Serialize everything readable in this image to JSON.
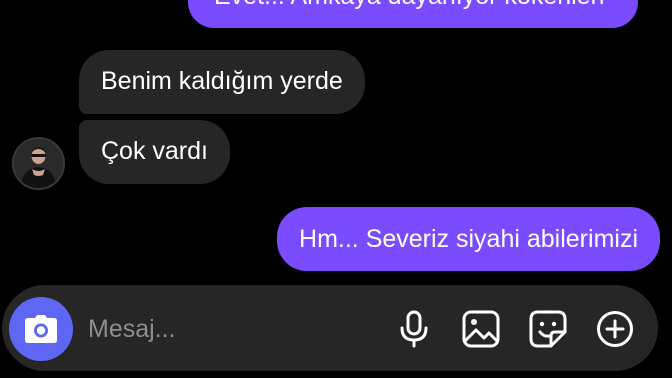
{
  "messages": [
    {
      "direction": "outgoing",
      "text": "Evet... Amkaya dayanıyor kökenleri"
    },
    {
      "direction": "incoming",
      "text": "Benim kaldığım yerde"
    },
    {
      "direction": "incoming",
      "text": "Çok vardı"
    },
    {
      "direction": "outgoing",
      "text": "Hm... Severiz siyahi abilerimizi"
    }
  ],
  "composer": {
    "placeholder": "Mesaj...",
    "icons": [
      "camera-icon",
      "microphone-icon",
      "gallery-icon",
      "sticker-icon",
      "plus-icon"
    ]
  },
  "colors": {
    "background": "#000000",
    "incoming_bubble": "#262626",
    "outgoing_bubble": "#7a4bff",
    "camera_button": "#5f66f3",
    "composer": "#262626"
  }
}
